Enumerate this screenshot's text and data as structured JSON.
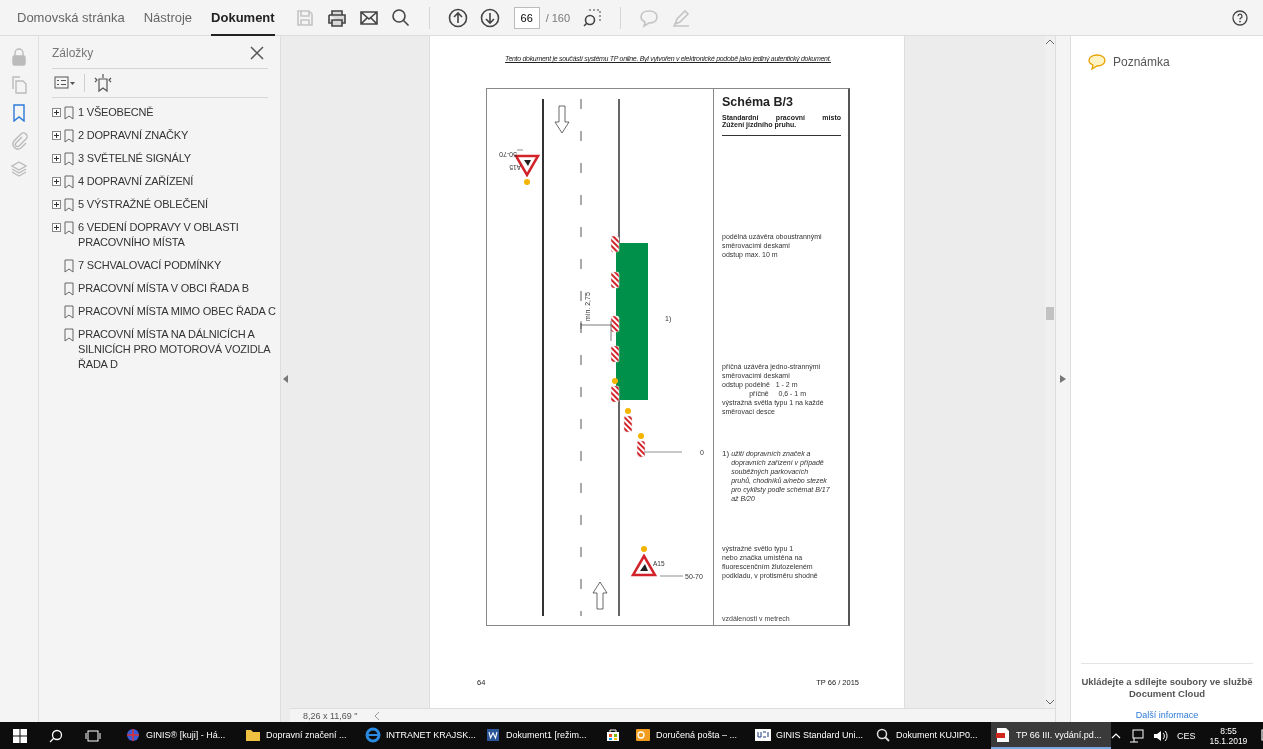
{
  "toolbar": {
    "tabs": [
      {
        "label": "Domovská stránka",
        "selected": false
      },
      {
        "label": "Nástroje",
        "selected": false
      },
      {
        "label": "Dokument",
        "selected": true
      }
    ],
    "tools": [
      {
        "kind": "save",
        "disabled": true
      },
      {
        "kind": "print",
        "disabled": false
      },
      {
        "kind": "mail",
        "disabled": false
      },
      {
        "kind": "search",
        "disabled": false
      },
      {
        "kind": "separator"
      },
      {
        "kind": "up",
        "disabled": false
      },
      {
        "kind": "down",
        "disabled": false
      },
      {
        "kind": "page"
      },
      {
        "kind": "marquee",
        "disabled": false
      },
      {
        "kind": "separator"
      },
      {
        "kind": "comment",
        "disabled": true
      },
      {
        "kind": "pen",
        "disabled": true
      }
    ],
    "page_number": "66",
    "page_total": "/ 160"
  },
  "rail": [
    {
      "kind": "lock",
      "selected": false
    },
    {
      "kind": "pages",
      "selected": false
    },
    {
      "kind": "bookmark",
      "selected": true
    },
    {
      "kind": "clip",
      "selected": false
    },
    {
      "kind": "layers",
      "selected": false
    }
  ],
  "bookmarks": {
    "title": "Záložky",
    "items": [
      {
        "label": "1 VŠEOBECNĚ",
        "expandable": true
      },
      {
        "label": "2 DOPRAVNÍ ZNAČKY",
        "expandable": true
      },
      {
        "label": "3 SVĚTELNÉ SIGNÁLY",
        "expandable": true
      },
      {
        "label": "4 DOPRAVNÍ ZAŘÍZENÍ",
        "expandable": true
      },
      {
        "label": "5 VÝSTRAŽNÉ OBLEČENÍ",
        "expandable": true
      },
      {
        "label": "6 VEDENÍ DOPRAVY V OBLASTI PRACOVNÍHO MÍSTA",
        "expandable": true
      },
      {
        "label": "7 SCHVALOVACÍ PODMÍNKY",
        "expandable": false
      },
      {
        "label": "PRACOVNÍ MÍSTA V OBCI ŘADA B",
        "expandable": false
      },
      {
        "label": "PRACOVNÍ MÍSTA MIMO OBEC ŘADA C",
        "expandable": false
      },
      {
        "label": "PRACOVNÍ MÍSTA NA DÁLNICÍCH A SILNICÍCH PRO MOTOROVÁ VOZIDLA ŘADA D",
        "expandable": false
      }
    ]
  },
  "page": {
    "header": "Tento dokument je součástí systému TP online. Byl vytvořen v elektronické podobě jako jediný autentický dokument.",
    "schema": {
      "title": "Schéma B/3",
      "subtitle": [
        "Standardní pracovní místo",
        "Zúžení jízdního pruhu."
      ],
      "labels": [
        {
          "kind": "top_distance",
          "text": "50-70"
        },
        {
          "kind": "top_sign",
          "text": "A15"
        },
        {
          "kind": "width",
          "text": "min. 2,75"
        },
        {
          "kind": "ref",
          "text": "1)"
        },
        {
          "kind": "zero",
          "text": "0"
        },
        {
          "kind": "bottom_sign",
          "text": "A15"
        },
        {
          "kind": "bottom_distance",
          "text": "50-70"
        }
      ],
      "notes": [
        {
          "kind": "plain",
          "lines": [
            "podélná uzávěra oboustrannými",
            "směrovacími deskami",
            "odstup max. 10 m"
          ]
        },
        {
          "kind": "plain",
          "lines": [
            "příčná uzávěra jedno-strannými",
            "směrovacími deskami",
            "odstup podélně   1 - 2 m",
            "              příčně     0,6 - 1 m",
            "výstražná světla typu 1 na každé",
            "směrovací desce"
          ]
        },
        {
          "kind": "footnote",
          "marker": "1)",
          "lines": [
            "užití dopravních značek a",
            "dopravních zařízení v případě",
            "souběžných parkovacích",
            "pruhů, chodníků a/nebo stezek",
            "pro cyklisty podle schémat B/17",
            "až B/20"
          ]
        },
        {
          "kind": "plain",
          "lines": [
            "výstražné světlo typu 1",
            "nebo značka umístěna na",
            "fluorescenčním žlutozeleném",
            "podkladu, v protisměru shodně"
          ]
        }
      ],
      "footer": "vzdálenosti v metrech"
    },
    "page_number": "64",
    "doc_code": "TP 66 / 2015"
  },
  "status": "8,26 x 11,69 \"",
  "comments": {
    "label": "Poznámka"
  },
  "cloud": {
    "text": "Ukládejte a sdílejte soubory ve službě Document Cloud",
    "link": "Další informace"
  },
  "taskbar": {
    "apps": [
      {
        "kind": "ginis",
        "label": "GINIS® [kuji] - Há...",
        "selected": false
      },
      {
        "kind": "folder",
        "label": "Dopravní značení ...",
        "selected": false
      },
      {
        "kind": "ie",
        "label": "INTRANET KRAJSK...",
        "selected": false
      },
      {
        "kind": "word",
        "label": "Dokument1 [režim...",
        "selected": false
      },
      {
        "kind": "store",
        "selected": false
      },
      {
        "kind": "outlook",
        "label": "Doručená pošta – ...",
        "selected": false
      },
      {
        "kind": "usu",
        "label": "GINIS Standard Uni...",
        "selected": false
      },
      {
        "kind": "magnifier",
        "label": "Dokument KUJIP0...",
        "selected": false
      },
      {
        "kind": "pdf",
        "label": "TP 66 III. vydání.pd...",
        "selected": true
      }
    ],
    "language": "CES",
    "time": "8:55",
    "date": "15.1.2019"
  }
}
